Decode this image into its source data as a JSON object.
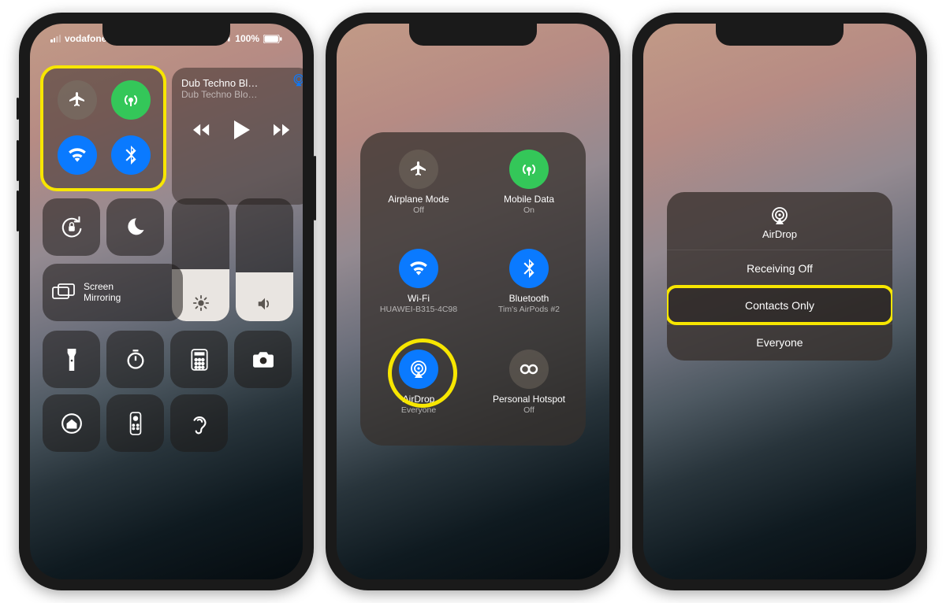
{
  "status": {
    "carrier": "vodafone UK",
    "battery": "100%"
  },
  "phone1": {
    "media": {
      "title": "Dub Techno Bl…",
      "subtitle": "Dub Techno Blo…"
    },
    "mirror": {
      "label": "Screen\nMirroring"
    }
  },
  "phone2": {
    "airplane": {
      "label": "Airplane Mode",
      "state": "Off"
    },
    "mobile": {
      "label": "Mobile Data",
      "state": "On"
    },
    "wifi": {
      "label": "Wi-Fi",
      "state": "HUAWEI-B315-4C98"
    },
    "bt": {
      "label": "Bluetooth",
      "state": "Tim's AirPods #2"
    },
    "airdrop": {
      "label": "AirDrop",
      "state": "Everyone"
    },
    "hotspot": {
      "label": "Personal Hotspot",
      "state": "Off"
    }
  },
  "phone3": {
    "title": "AirDrop",
    "options": {
      "off": "Receiving Off",
      "contacts": "Contacts Only",
      "everyone": "Everyone"
    }
  }
}
